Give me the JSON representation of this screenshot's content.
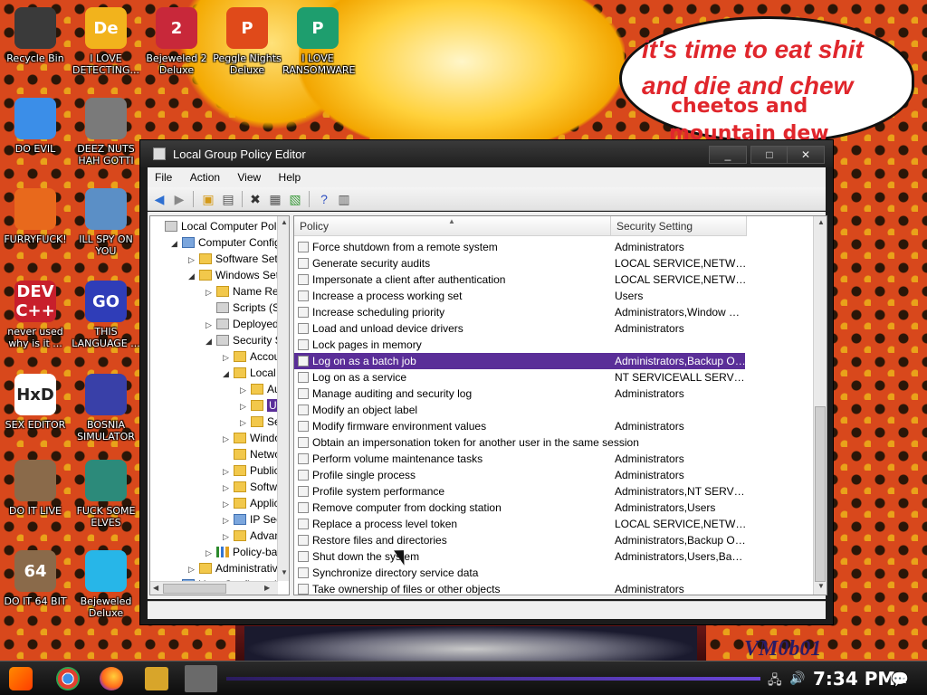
{
  "wallpaper": {
    "speech_line1": "it's time to eat shit",
    "speech_line2": "and die and chew",
    "speech_line3": "cheetos and",
    "speech_line4": "mountain dew",
    "watermark": "VM0b01"
  },
  "desktop_icons": [
    {
      "label": "Recycle Bin",
      "icon": "recycle-bin-icon",
      "color": "#3a3a3a",
      "glyph": ""
    },
    {
      "label": "I LOVE DETECTING...",
      "icon": "de-icon",
      "color": "#f2b31c",
      "glyph": "De"
    },
    {
      "label": "Bejeweled 2 Deluxe",
      "icon": "bejeweled2-icon",
      "color": "#c8283a",
      "glyph": "2"
    },
    {
      "label": "Peggle Nights Deluxe",
      "icon": "peggle-icon",
      "color": "#e04a1a",
      "glyph": "P"
    },
    {
      "label": "I LOVE RANSOMWARE",
      "icon": "publisher-icon",
      "color": "#1e9e6e",
      "glyph": "P"
    },
    {
      "label": "DO EVIL",
      "icon": "chrome-icon",
      "color": "#3b8ee8",
      "glyph": ""
    },
    {
      "label": "DEEZ NUTS HAH GOTTI",
      "icon": "stack-icon",
      "color": "#7a7a7a",
      "glyph": ""
    },
    {
      "label": "FURRYFUCK!",
      "icon": "firefox-icon",
      "color": "#e8691c",
      "glyph": ""
    },
    {
      "label": "ILL SPY ON YOU",
      "icon": "spy-icon",
      "color": "#5b8fc6",
      "glyph": ""
    },
    {
      "label": "never used why is it ...",
      "icon": "devcpp-icon",
      "color": "#c81f2c",
      "glyph": "DEV C++"
    },
    {
      "label": "THIS LANGUAGE ...",
      "icon": "goland-icon",
      "color": "#2f3db8",
      "glyph": "GO"
    },
    {
      "label": "SEX EDITOR",
      "icon": "hxd-icon",
      "color": "#ffffff",
      "glyph": "HxD"
    },
    {
      "label": "BOSNIA SIMULATOR",
      "icon": "mine-icon",
      "color": "#3940a8",
      "glyph": ""
    },
    {
      "label": "DO IT LIVE",
      "icon": "portrait-icon",
      "color": "#8a6a4a",
      "glyph": ""
    },
    {
      "label": "FUCK SOME ELVES",
      "icon": "santa-icon",
      "color": "#2c8a7a",
      "glyph": ""
    },
    {
      "label": "DO IT 64 BIT",
      "icon": "portrait64-icon",
      "color": "#8a6a4a",
      "glyph": "64"
    },
    {
      "label": "Bejeweled Deluxe",
      "icon": "diamond-icon",
      "color": "#27b6e8",
      "glyph": ""
    }
  ],
  "window": {
    "title": "Local Group Policy Editor",
    "minimize": "_",
    "maximize": "□",
    "close": "✕",
    "menu": [
      "File",
      "Action",
      "View",
      "Help"
    ]
  },
  "tree": {
    "nodes": [
      {
        "label": "Local Computer Policy",
        "expander": "",
        "icon": "gray",
        "depth": 0
      },
      {
        "label": "Computer Configu",
        "expander": "◢",
        "icon": "blue",
        "depth": 1
      },
      {
        "label": "Software Setti",
        "expander": "▷",
        "icon": "folder",
        "depth": 2
      },
      {
        "label": "Windows Setti",
        "expander": "◢",
        "icon": "folder",
        "depth": 2
      },
      {
        "label": "Name Reso",
        "expander": "▷",
        "icon": "folder",
        "depth": 3
      },
      {
        "label": "Scripts (St",
        "expander": "",
        "icon": "gray",
        "depth": 3
      },
      {
        "label": "Deployed P",
        "expander": "▷",
        "icon": "gray",
        "depth": 3
      },
      {
        "label": "Security S",
        "expander": "◢",
        "icon": "gray",
        "depth": 3
      },
      {
        "label": "Accou",
        "expander": "▷",
        "icon": "folder",
        "depth": 4
      },
      {
        "label": "Local P",
        "expander": "◢",
        "icon": "folder",
        "depth": 4
      },
      {
        "label": "Aud",
        "expander": "▷",
        "icon": "folder",
        "depth": 5
      },
      {
        "label": "Use",
        "expander": "▷",
        "icon": "folder",
        "depth": 5,
        "selected": true
      },
      {
        "label": "Sec",
        "expander": "▷",
        "icon": "folder",
        "depth": 5
      },
      {
        "label": "Window",
        "expander": "▷",
        "icon": "folder",
        "depth": 4
      },
      {
        "label": "Networ",
        "expander": "",
        "icon": "folder",
        "depth": 4
      },
      {
        "label": "Public K",
        "expander": "▷",
        "icon": "folder",
        "depth": 4
      },
      {
        "label": "Softwa",
        "expander": "▷",
        "icon": "folder",
        "depth": 4
      },
      {
        "label": "Applica",
        "expander": "▷",
        "icon": "folder",
        "depth": 4
      },
      {
        "label": "IP Secu",
        "expander": "▷",
        "icon": "blue",
        "depth": 4
      },
      {
        "label": "Advanc",
        "expander": "▷",
        "icon": "folder",
        "depth": 4
      },
      {
        "label": "Policy-base",
        "expander": "▷",
        "icon": "bars",
        "depth": 3
      },
      {
        "label": "Administrative",
        "expander": "▷",
        "icon": "folder",
        "depth": 2
      },
      {
        "label": "User Configurati",
        "expander": "◢",
        "icon": "blue",
        "depth": 1
      }
    ]
  },
  "list": {
    "col_policy": "Policy",
    "col_setting": "Security Setting",
    "rows": [
      {
        "policy": "Force shutdown from a remote system",
        "setting": "Administrators"
      },
      {
        "policy": "Generate security audits",
        "setting": "LOCAL SERVICE,NETWORK..."
      },
      {
        "policy": "Impersonate a client after authentication",
        "setting": "LOCAL SERVICE,NETWORK..."
      },
      {
        "policy": "Increase a process working set",
        "setting": "Users"
      },
      {
        "policy": "Increase scheduling priority",
        "setting": "Administrators,Window Ma..."
      },
      {
        "policy": "Load and unload device drivers",
        "setting": "Administrators"
      },
      {
        "policy": "Lock pages in memory",
        "setting": ""
      },
      {
        "policy": "Log on as a batch job",
        "setting": "Administrators,Backup Op...",
        "selected": true
      },
      {
        "policy": "Log on as a service",
        "setting": "NT SERVICE\\ALL SERVICES"
      },
      {
        "policy": "Manage auditing and security log",
        "setting": "Administrators"
      },
      {
        "policy": "Modify an object label",
        "setting": ""
      },
      {
        "policy": "Modify firmware environment values",
        "setting": "Administrators"
      },
      {
        "policy": "Obtain an impersonation token for another user in the same session",
        "setting": ""
      },
      {
        "policy": "Perform volume maintenance tasks",
        "setting": "Administrators"
      },
      {
        "policy": "Profile single process",
        "setting": "Administrators"
      },
      {
        "policy": "Profile system performance",
        "setting": "Administrators,NT SERVIC..."
      },
      {
        "policy": "Remove computer from docking station",
        "setting": "Administrators,Users"
      },
      {
        "policy": "Replace a process level token",
        "setting": "LOCAL SERVICE,NETWORK..."
      },
      {
        "policy": "Restore files and directories",
        "setting": "Administrators,Backup Op..."
      },
      {
        "policy": "Shut down the system",
        "setting": "Administrators,Users,Back..."
      },
      {
        "policy": "Synchronize directory service data",
        "setting": ""
      },
      {
        "policy": "Take ownership of files or other objects",
        "setting": "Administrators"
      }
    ]
  },
  "taskbar": {
    "clock": "7:34 PM",
    "notification_count": "1"
  }
}
